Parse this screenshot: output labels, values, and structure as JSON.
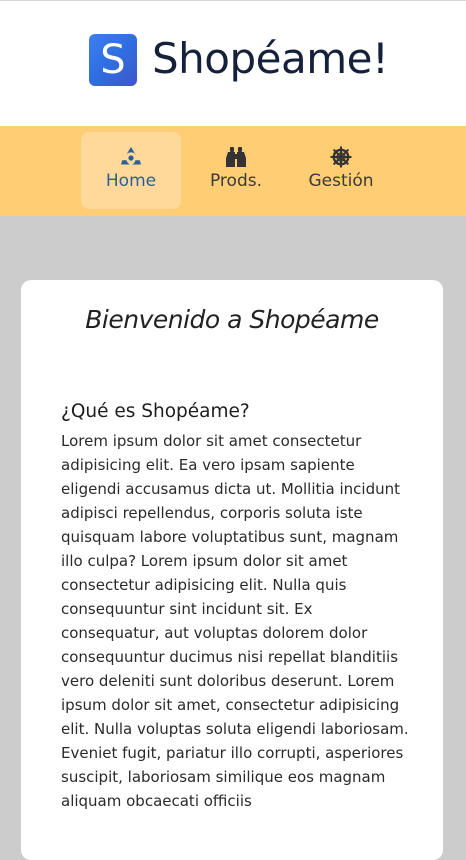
{
  "header": {
    "logo_letter": "S",
    "app_title": "Shopéame!"
  },
  "nav": {
    "items": [
      {
        "label": "Home",
        "icon": "radiation-icon",
        "active": true
      },
      {
        "label": "Prods.",
        "icon": "binoculars-icon",
        "active": false
      },
      {
        "label": "Gestión",
        "icon": "dharmachakra-icon",
        "active": false
      }
    ]
  },
  "main": {
    "title": "Bienvenido a Shopéame",
    "section_heading": "¿Qué es Shopéame?",
    "section_body": "Lorem ipsum dolor sit amet consectetur adipisicing elit. Ea vero ipsam sapiente eligendi accusamus dicta ut. Mollitia incidunt adipisci repellendus, corporis soluta iste quisquam labore voluptatibus sunt, magnam illo culpa? Lorem ipsum dolor sit amet consectetur adipisicing elit. Nulla quis consequuntur sint incidunt sit. Ex consequatur, aut voluptas dolorem dolor consequuntur ducimus nisi repellat blanditiis vero deleniti sunt doloribus deserunt. Lorem ipsum dolor sit amet, consectetur adipisicing elit. Nulla voluptas soluta eligendi laboriosam. Eveniet fugit, pariatur illo corrupti, asperiores suscipit, laboriosam similique eos magnam aliquam obcaecati officiis"
  },
  "colors": {
    "nav_background": "#ffcd73",
    "nav_active_background": "#ffd99a",
    "logo_gradient_start": "#3c7ff0",
    "logo_gradient_end": "#3f56c9",
    "page_background": "#cccccc",
    "title_color": "#15203b",
    "active_icon_color": "#2c5f96"
  }
}
